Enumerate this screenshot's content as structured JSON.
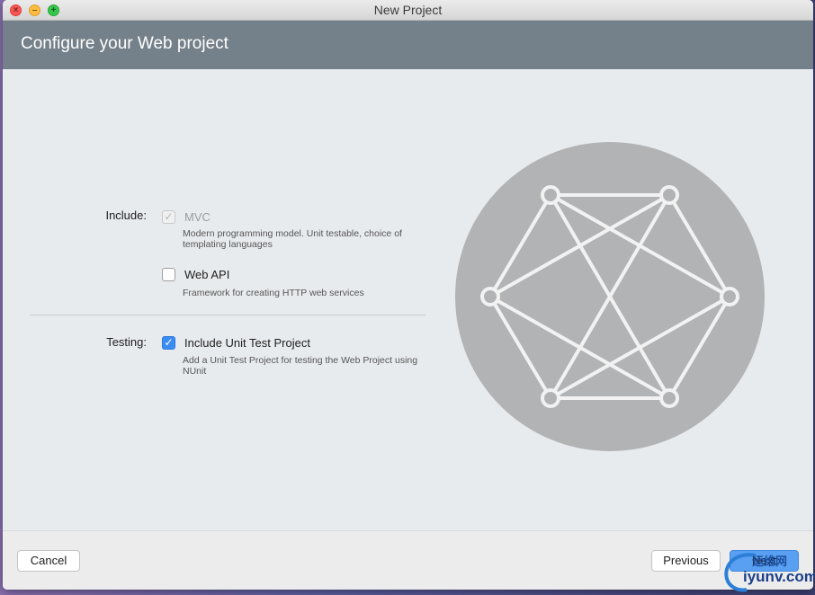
{
  "window": {
    "title": "New Project",
    "header_title": "Configure your Web project"
  },
  "include": {
    "label": "Include:",
    "options": [
      {
        "title": "MVC",
        "description": "Modern programming model. Unit testable, choice of templating languages",
        "checked": true,
        "disabled": true
      },
      {
        "title": "Web API",
        "description": "Framework for creating HTTP web services",
        "checked": false,
        "disabled": false
      }
    ]
  },
  "testing": {
    "label": "Testing:",
    "options": [
      {
        "title": "Include Unit Test Project",
        "description": "Add a Unit Test Project for testing the Web Project using NUnit",
        "checked": true,
        "disabled": false
      }
    ]
  },
  "footer": {
    "cancel_label": "Cancel",
    "previous_label": "Previous",
    "next_label": "Next"
  },
  "watermark": {
    "line1": "运维网",
    "line2": "iyunv.com"
  },
  "colors": {
    "header_bg": "#75818a",
    "accent": "#3b8cf3",
    "illustration_circle": "#b2b3b5"
  },
  "icons": {
    "check": "✓"
  }
}
